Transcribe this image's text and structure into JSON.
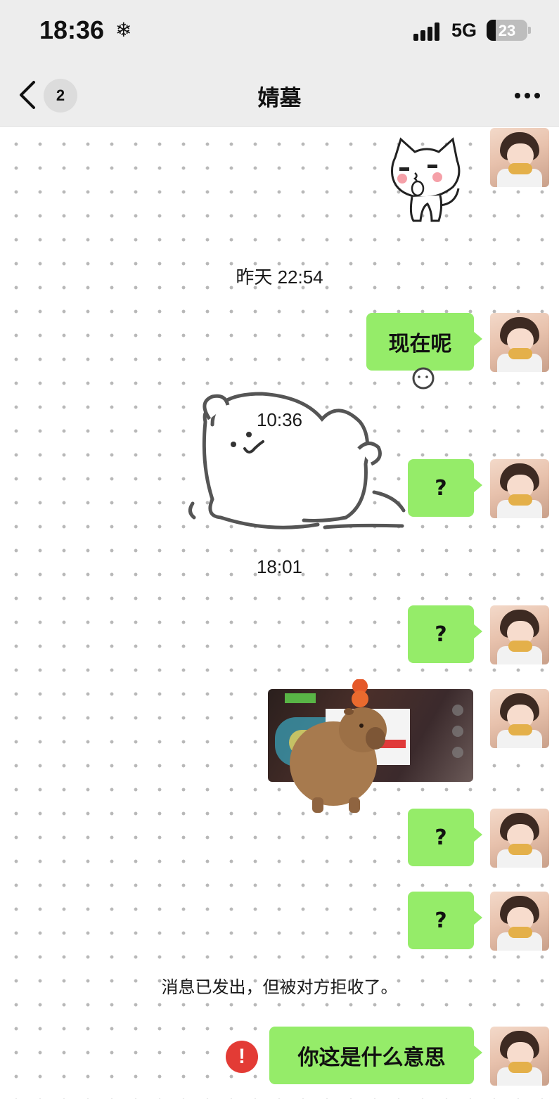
{
  "status_bar": {
    "time": "18:36",
    "weather_symbol": "❄",
    "network": "5G",
    "battery": "23",
    "battery_level": 0.23
  },
  "header": {
    "back_icon": "chevron-left-icon",
    "unread_count": "2",
    "title": "婧墓",
    "more_icon": "more-horizontal-icon"
  },
  "messages": [
    {
      "type": "sticker",
      "sender": "me",
      "sticker": "white-cat-kiss-sticker"
    },
    {
      "type": "timestamp",
      "text": "昨天 22:54"
    },
    {
      "type": "text",
      "sender": "me",
      "text": "现在呢"
    },
    {
      "type": "sticker",
      "sender": "other",
      "sticker": "white-bear-lying-sticker"
    },
    {
      "type": "timestamp",
      "text": "10:36"
    },
    {
      "type": "text",
      "sender": "me",
      "text": "?"
    },
    {
      "type": "timestamp",
      "text": "18:01"
    },
    {
      "type": "text",
      "sender": "me",
      "text": "?"
    },
    {
      "type": "image",
      "sender": "me",
      "description": "capybara-sticker-over-game-screenshot"
    },
    {
      "type": "text",
      "sender": "me",
      "text": "?"
    },
    {
      "type": "text",
      "sender": "me",
      "text": "?"
    },
    {
      "type": "system",
      "text": "消息已发出，但被对方拒收了。"
    },
    {
      "type": "text",
      "sender": "me",
      "text": "你这是什么意思",
      "status": "failed"
    }
  ],
  "colors": {
    "bubble": "#95ec69",
    "header_bg": "#ededed",
    "error": "#e33b35"
  }
}
